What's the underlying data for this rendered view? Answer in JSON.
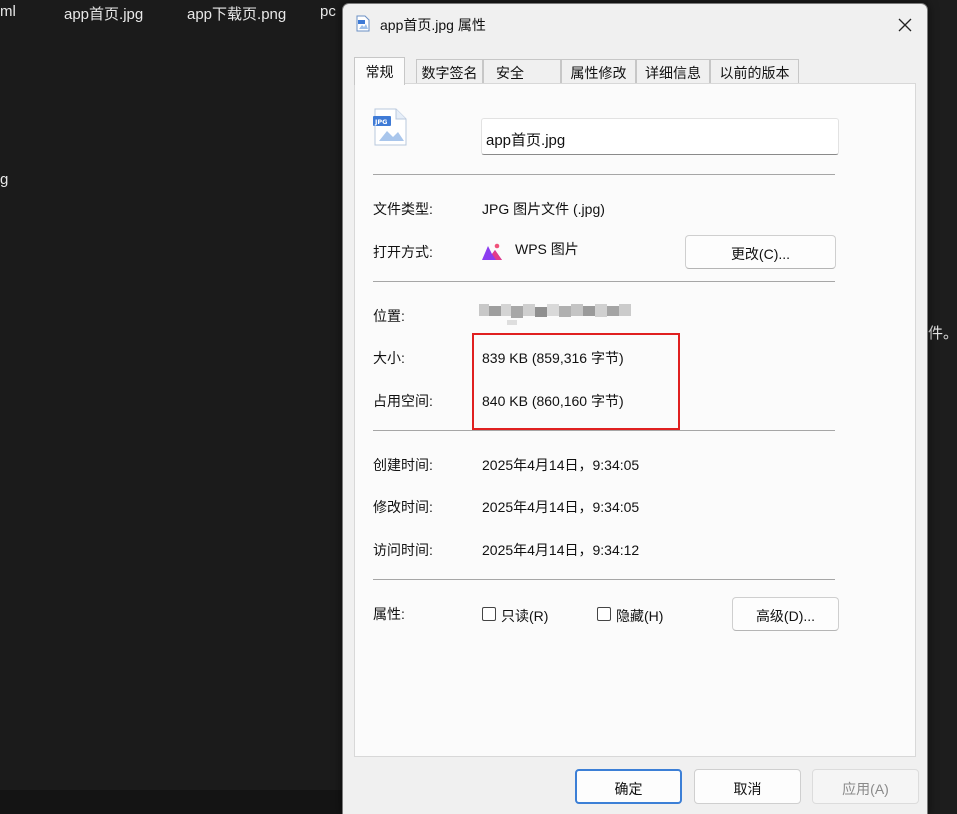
{
  "background": {
    "files": [
      "ml",
      "app首页.jpg",
      "app下载页.png",
      "pc"
    ],
    "left_fragment": "g",
    "right_fragment": "件。"
  },
  "dialog": {
    "title": "app首页.jpg 属性",
    "tabs": [
      {
        "label": "常规",
        "active": true
      },
      {
        "label": "数字签名",
        "active": false
      },
      {
        "label": "安全",
        "active": false
      },
      {
        "label": "属性修改",
        "active": false
      },
      {
        "label": "详细信息",
        "active": false
      },
      {
        "label": "以前的版本",
        "active": false
      }
    ],
    "general": {
      "filename": "app首页.jpg",
      "file_type_label": "文件类型:",
      "file_type_value": "JPG 图片文件 (.jpg)",
      "open_with_label": "打开方式:",
      "open_with_value": "WPS 图片",
      "change_button": "更改(C)...",
      "location_label": "位置:",
      "size_label": "大小:",
      "size_value": "839 KB (859,316 字节)",
      "size_on_disk_label": "占用空间:",
      "size_on_disk_value": "840 KB (860,160 字节)",
      "created_label": "创建时间:",
      "created_value": "2025年4月14日，9:34:05",
      "modified_label": "修改时间:",
      "modified_value": "2025年4月14日，9:34:05",
      "accessed_label": "访问时间:",
      "accessed_value": "2025年4月14日，9:34:12",
      "attributes_label": "属性:",
      "readonly_label": "只读(R)",
      "hidden_label": "隐藏(H)",
      "advanced_button": "高级(D)..."
    },
    "footer": {
      "ok": "确定",
      "cancel": "取消",
      "apply": "应用(A)"
    }
  },
  "colors": {
    "highlight_box": "#e02020",
    "ok_border": "#3c7fd6",
    "background": "#1b1b1b"
  }
}
